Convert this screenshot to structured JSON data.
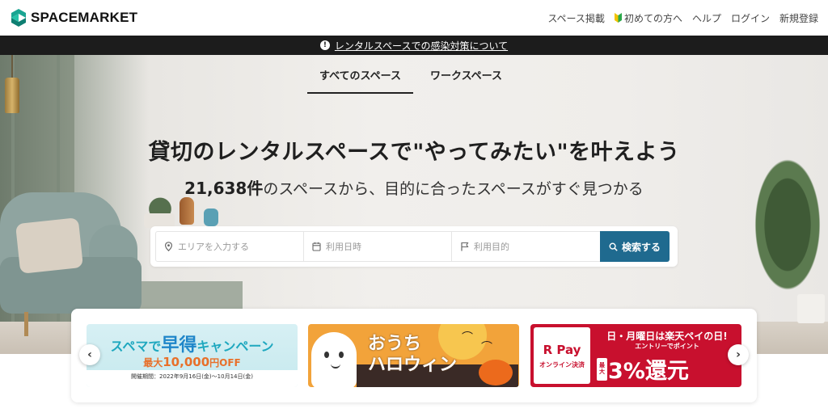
{
  "header": {
    "logo_text": "SPACEMARKET",
    "nav": [
      {
        "label": "スペース掲載"
      },
      {
        "label": "初めての方へ"
      },
      {
        "label": "ヘルプ"
      },
      {
        "label": "ログイン"
      },
      {
        "label": "新規登録"
      }
    ]
  },
  "notice": {
    "icon_glyph": "!",
    "link_text": "レンタルスペースでの感染対策について"
  },
  "tabs": [
    {
      "label": "すべてのスペース",
      "active": true
    },
    {
      "label": "ワークスペース",
      "active": false
    }
  ],
  "hero": {
    "headline": "貸切のレンタルスペースで\"やってみたい\"を叶えよう",
    "count": "21,638件",
    "subline_rest": "のスペースから、目的に合ったスペースがすぐ見つかる"
  },
  "search": {
    "area_placeholder": "エリアを入力する",
    "date_placeholder": "利用日時",
    "purpose_placeholder": "利用目的",
    "button_label": "検索する"
  },
  "banners": {
    "b1": {
      "line1_a": "スペマで",
      "line1_big": "早得",
      "line1_b": "キャンペーン",
      "line2_a": "最大",
      "line2_amt": "10,000",
      "line2_b": "円OFF",
      "period": "開催期間：2022年9月16日(金)～10月14日(金)"
    },
    "b2": {
      "line1": "おうち",
      "line2": "ハロウィン"
    },
    "b3": {
      "logo": "R Pay",
      "logo_sub": "オンライン決済",
      "line1": "日・月曜日は楽天ペイの日!",
      "line2": "エントリーでポイント",
      "max_a": "最",
      "max_b": "大",
      "big": "3%還元"
    }
  },
  "carousel": {
    "prev_glyph": "‹",
    "next_glyph": "›"
  },
  "colors": {
    "search_button": "#1f6a8f",
    "notice_bar": "#1c1c1c",
    "rakuten_red": "#c8102e",
    "halloween_orange": "#f2a33a"
  }
}
